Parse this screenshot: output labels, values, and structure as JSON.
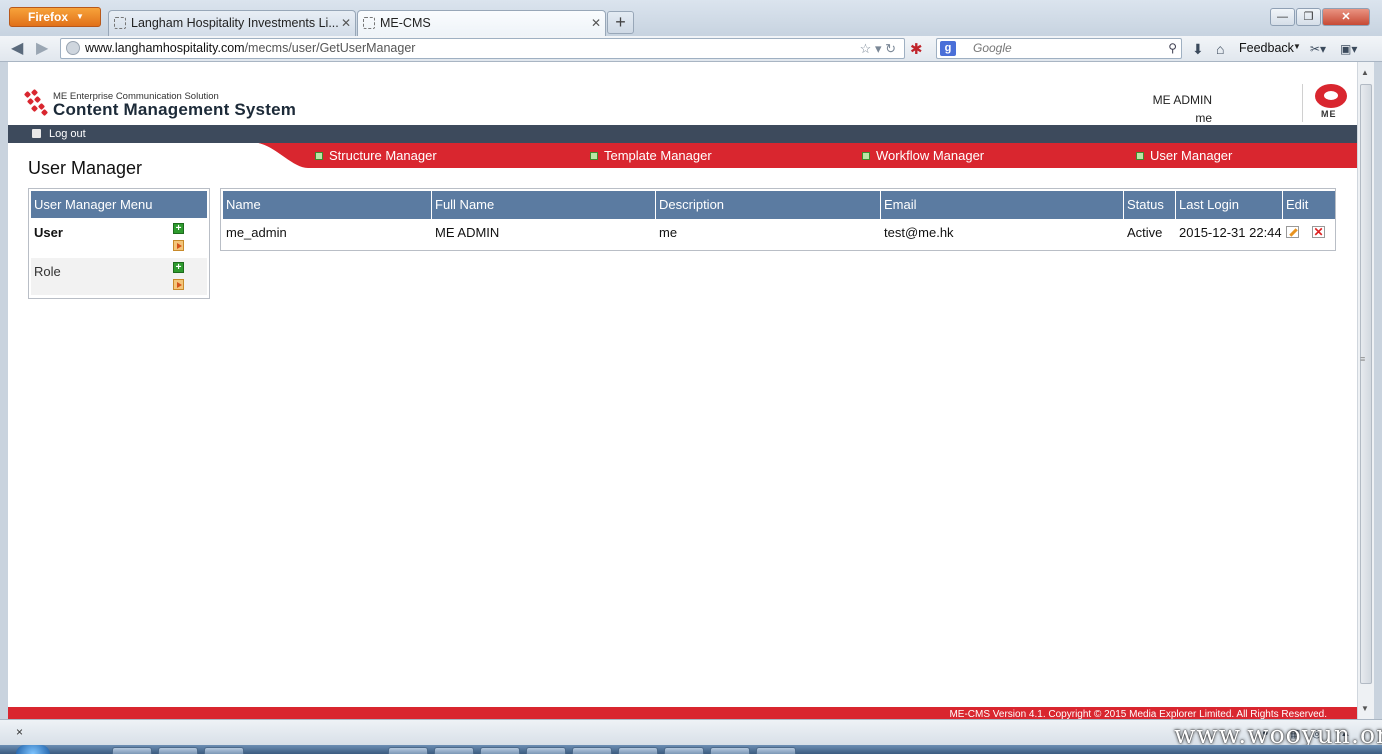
{
  "browser": {
    "menu_button": "Firefox",
    "tabs": [
      {
        "title": "Langham Hospitality Investments Li..."
      },
      {
        "title": "ME-CMS"
      }
    ],
    "new_tab": "+",
    "url_host": "www.langhamhospitality.com",
    "url_path": "/mecms/user/GetUserManager",
    "search_placeholder": "Google",
    "search_engine_glyph": "g",
    "feedback_label": "Feedback",
    "addon_close": "×"
  },
  "header": {
    "logo_subtitle": "ME Enterprise Communication Solution",
    "logo_title": "Content Management System",
    "user_fullname": "ME ADMIN",
    "user_description": "me",
    "brand_text": "ME"
  },
  "topbar": {
    "logout_label": "Log out"
  },
  "nav": {
    "items": [
      {
        "label": "Structure Manager"
      },
      {
        "label": "Template Manager"
      },
      {
        "label": "Workflow Manager"
      },
      {
        "label": "User Manager"
      }
    ]
  },
  "page": {
    "title": "User Manager"
  },
  "menu": {
    "heading": "User Manager Menu",
    "items": [
      {
        "label": "User"
      },
      {
        "label": "Role"
      }
    ]
  },
  "table": {
    "columns": [
      "Name",
      "Full Name",
      "Description",
      "Email",
      "Status",
      "Last Login",
      "Edit"
    ],
    "rows": [
      {
        "name": "me_admin",
        "full_name": "ME ADMIN",
        "description": "me",
        "email": "test@me.hk",
        "status": "Active",
        "last_login": "2015-12-31 22:44"
      }
    ]
  },
  "footer": {
    "text": "ME-CMS Version 4.1. Copyright © 2015 Media Explorer Limited. All Rights Reserved."
  },
  "watermark": "www.wooyun.org",
  "colors": {
    "brand_red": "#d9262f",
    "nav_dark": "#3d4a5c",
    "table_header": "#5b7ba1",
    "firefox_orange": "#e1711a"
  }
}
